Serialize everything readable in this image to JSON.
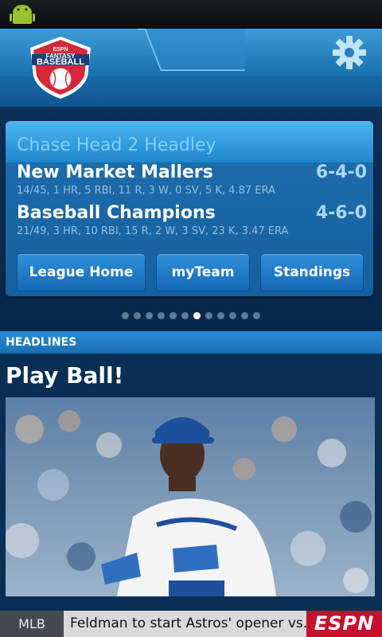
{
  "app": {
    "logo_small": "ESPN",
    "logo_title": "FANTASY",
    "logo_subtitle": "BASEBALL"
  },
  "matchup": {
    "title": "Chase Head 2 Headley",
    "teams": [
      {
        "name": "New Market Mallers",
        "record": "6-4-0",
        "stats": "14/45, 1 HR, 5 RBI, 11 R, 3 W, 0 SV, 5 K, 4.87 ERA"
      },
      {
        "name": "Baseball Champions",
        "record": "4-6-0",
        "stats": "21/49, 3 HR, 10 RBI, 15 R, 2 W, 3 SV, 23 K, 3.47 ERA"
      }
    ]
  },
  "buttons": {
    "league_home": "League Home",
    "my_team": "myTeam",
    "standings": "Standings"
  },
  "pager": {
    "count": 12,
    "active_index": 6
  },
  "headlines": {
    "section_label": "HEADLINES",
    "title": "Play Ball!"
  },
  "ticker": {
    "league": "MLB",
    "text": "Feldman to start Astros' opener vs.",
    "brand": "ESPN"
  },
  "colors": {
    "accent": "#1e87cf",
    "background": "#0a2f55",
    "brand_red": "#c8102e"
  }
}
